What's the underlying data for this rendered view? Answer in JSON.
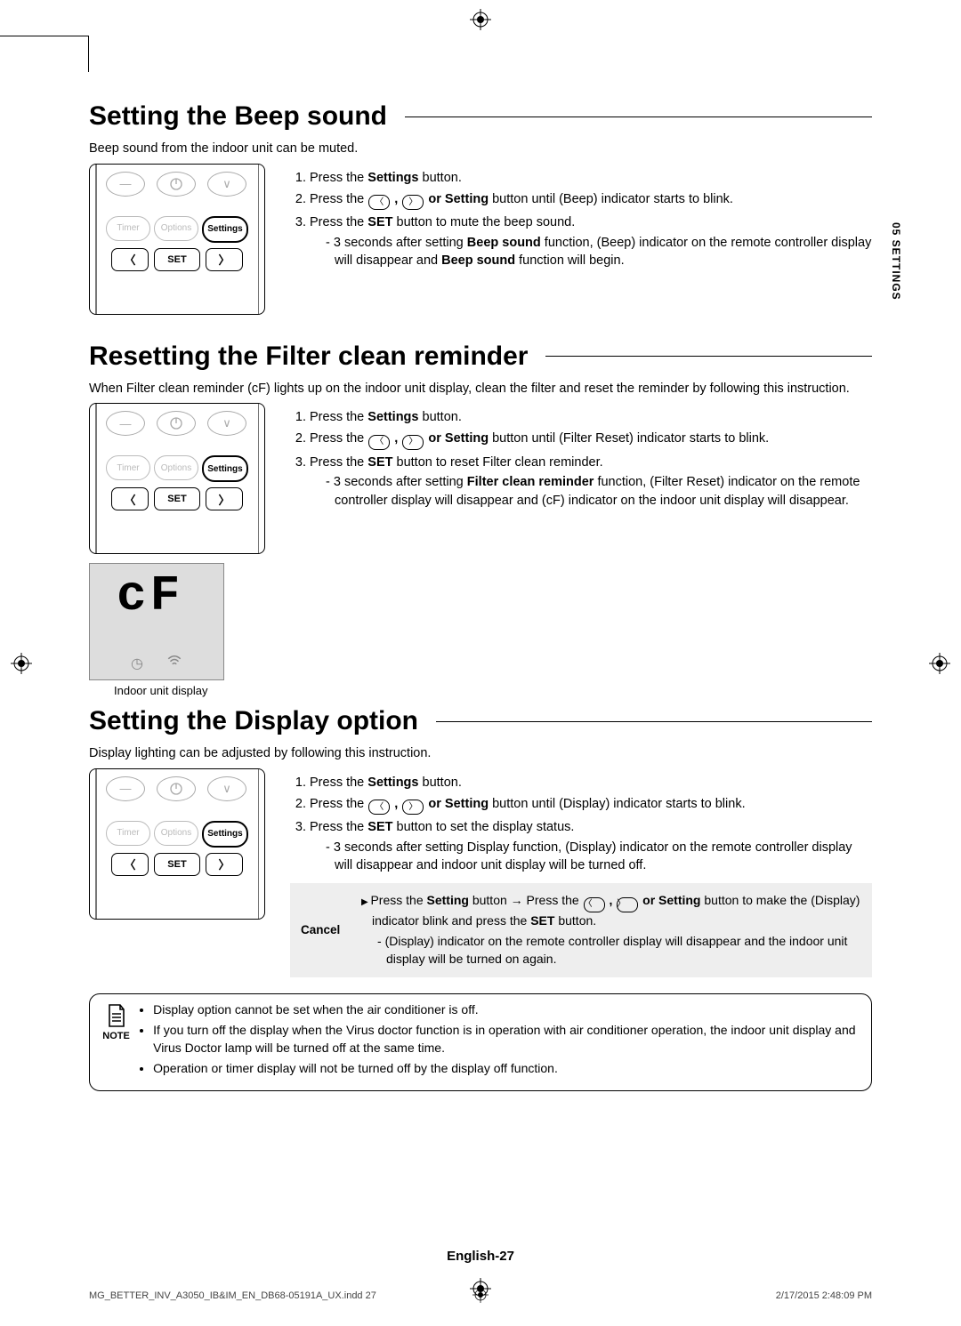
{
  "sideTab": "05  SETTINGS",
  "remote": {
    "timer": "Timer",
    "options": "Options",
    "settings": "Settings",
    "set": "SET"
  },
  "sec1": {
    "heading": "Setting the Beep sound",
    "intro": "Beep sound from the indoor unit can be muted.",
    "step1a": "Press the ",
    "step1b": "Settings",
    "step1c": " button.",
    "step2a": "Press the ",
    "step2b": " or Setting",
    "step2c": " button until (Beep) indicator starts to blink.",
    "step3a": "Press the ",
    "step3b": "SET",
    "step3c": " button to mute the beep sound.",
    "sub1a": "3 seconds after setting ",
    "sub1b": "Beep sound",
    "sub1c": " function, (Beep) indicator on the remote controller display will disappear and ",
    "sub1d": "Beep sound",
    "sub1e": " function will begin."
  },
  "sec2": {
    "heading": "Resetting the Filter clean reminder",
    "intro": "When Filter clean reminder (ᴄF) lights up on the indoor unit display, clean the filter and reset the reminder by following this instruction.",
    "step1a": "Press the ",
    "step1b": "Settings",
    "step1c": " button.",
    "step2a": "Press the ",
    "step2b": " or Setting",
    "step2c": " button until (Filter Reset) indicator starts to blink.",
    "step3a": "Press the ",
    "step3b": "SET",
    "step3c": " button to reset Filter clean reminder.",
    "sub1a": "3 seconds after setting ",
    "sub1b": "Filter clean reminder",
    "sub1c": " function, (Filter Reset) indicator on the remote controller display will disappear and (ᴄF)  indicator on the indoor unit display will disappear.",
    "unitCap": "Indoor unit display",
    "cf": "ᴄF"
  },
  "sec3": {
    "heading": "Setting the Display option",
    "intro": "Display lighting can be adjusted by following this instruction.",
    "step1a": "Press the ",
    "step1b": "Settings",
    "step1c": " button.",
    "step2a": "Press the ",
    "step2b": " or Setting",
    "step2c": " button until (Display) indicator starts to blink.",
    "step3a": "Press the ",
    "step3b": "SET",
    "step3c": " button to set the display status.",
    "sub1": "3 seconds after setting Display function, (Display) indicator on the remote controller display will disappear and indoor unit display will be turned off.",
    "cancelLabel": "Cancel",
    "cancel1a": "Press the ",
    "cancel1b": "Setting",
    "cancel1c": " button → Press the ",
    "cancel1d": " or Setting",
    "cancel1e": " button to make the (Display) indicator blink and press the ",
    "cancel1f": "SET",
    "cancel1g": " button.",
    "cancel2": "(Display) indicator on the remote controller display will disappear and the indoor unit display will be turned on again."
  },
  "note": {
    "label": "NOTE",
    "n1": "Display option cannot be set when the air conditioner is off.",
    "n2": "If you turn off the display when the Virus doctor function is in operation with air conditioner operation, the indoor unit display and Virus Doctor lamp will be turned off at the same time.",
    "n3": "Operation or timer display will not be turned off by the display off function."
  },
  "footer": {
    "page": "English-27",
    "file": "MG_BETTER_INV_A3050_IB&IM_EN_DB68-05191A_UX.indd   27",
    "date": "2/17/2015   2:48:09 PM"
  }
}
